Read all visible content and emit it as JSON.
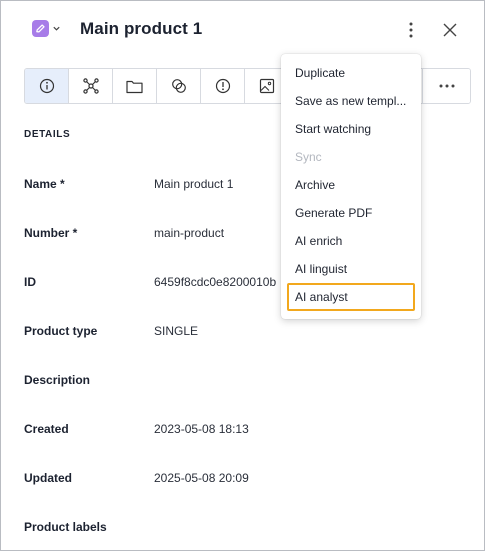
{
  "header": {
    "title": "Main product 1",
    "type_icon": "pencil-icon",
    "type_color": "#a77ce8"
  },
  "tabs": [
    {
      "icon": "info-icon",
      "active": true
    },
    {
      "icon": "network-icon",
      "active": false
    },
    {
      "icon": "folder-icon",
      "active": false
    },
    {
      "icon": "circles-icon",
      "active": false
    },
    {
      "icon": "alert-icon",
      "active": false
    },
    {
      "icon": "image-icon",
      "active": false
    }
  ],
  "details": {
    "section_title": "DETAILS",
    "fields": [
      {
        "label": "Name *",
        "value": "Main product 1"
      },
      {
        "label": "Number *",
        "value": "main-product"
      },
      {
        "label": "ID",
        "value": "6459f8cdc0e8200010b"
      },
      {
        "label": "Product type",
        "value": "SINGLE"
      },
      {
        "label": "Description",
        "value": ""
      },
      {
        "label": "Created",
        "value": "2023-05-08 18:13"
      },
      {
        "label": "Updated",
        "value": "2025-05-08 20:09"
      },
      {
        "label": "Product labels",
        "value": ""
      }
    ]
  },
  "menu": {
    "items": [
      {
        "label": "Duplicate",
        "disabled": false
      },
      {
        "label": "Save as new templ...",
        "disabled": false
      },
      {
        "label": "Start watching",
        "disabled": false
      },
      {
        "label": "Sync",
        "disabled": true
      },
      {
        "label": "Archive",
        "disabled": false
      },
      {
        "label": "Generate PDF",
        "disabled": false
      },
      {
        "label": "AI enrich",
        "disabled": false
      },
      {
        "label": "AI linguist",
        "disabled": false
      },
      {
        "label": "AI analyst",
        "disabled": false,
        "highlighted": true
      }
    ],
    "highlight_color": "#f2a81d"
  }
}
